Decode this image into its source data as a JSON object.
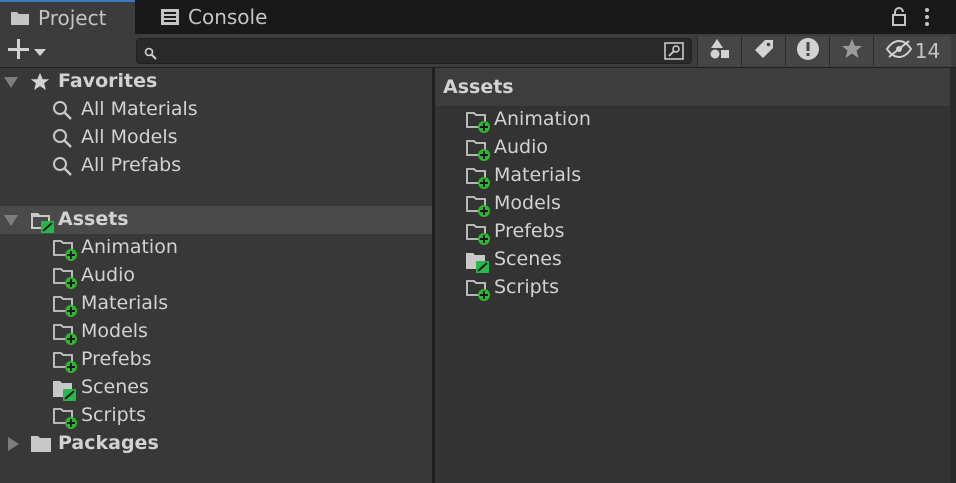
{
  "tabs": {
    "project": "Project",
    "console": "Console"
  },
  "toolbar": {
    "search_placeholder": "",
    "hidden_count": "14"
  },
  "favorites": {
    "label": "Favorites",
    "items": [
      "All Materials",
      "All Models",
      "All Prefabs"
    ]
  },
  "assets": {
    "label": "Assets",
    "items": [
      "Animation",
      "Audio",
      "Materials",
      "Models",
      "Prefebs",
      "Scenes",
      "Scripts"
    ]
  },
  "packages": {
    "label": "Packages"
  },
  "content": {
    "header": "Assets",
    "items": [
      "Animation",
      "Audio",
      "Materials",
      "Models",
      "Prefebs",
      "Scenes",
      "Scripts"
    ]
  },
  "colors": {
    "accent": "#3a79bb",
    "added_badge": "#2fb52f",
    "modified_badge": "#27b84a"
  }
}
